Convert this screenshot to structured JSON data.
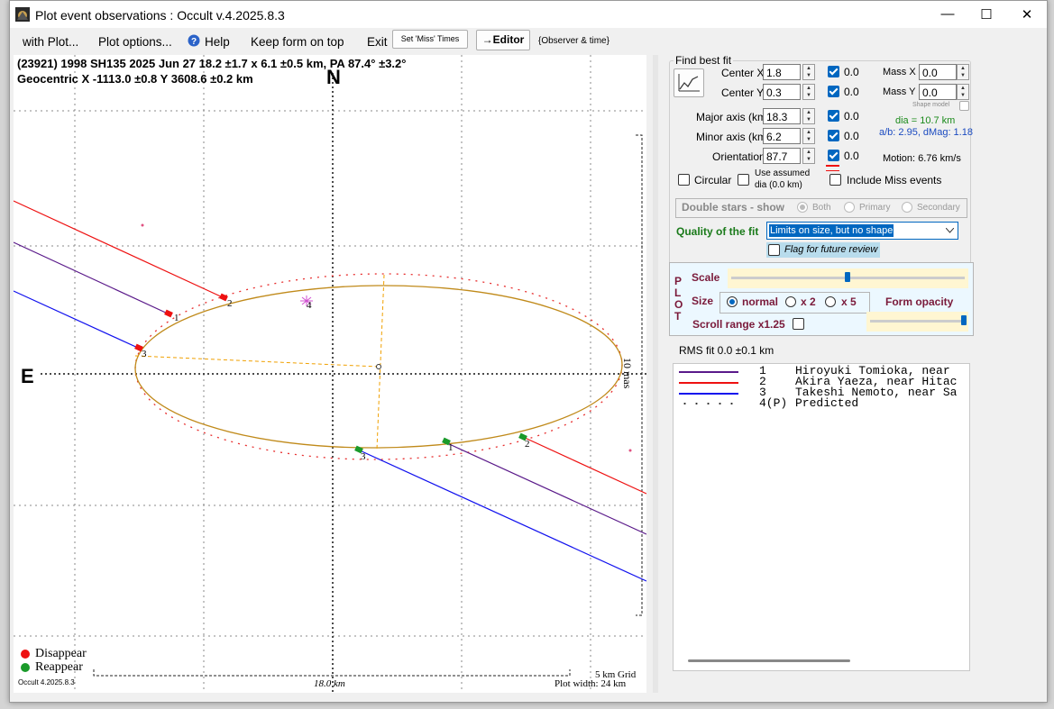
{
  "window": {
    "title": "Plot event observations : Occult v.4.2025.8.3",
    "minimize": "—",
    "maximize": "☐",
    "close": "✕"
  },
  "menu": {
    "with_plot": "with Plot...",
    "plot_options": "Plot options...",
    "help": "Help",
    "keep_on_top": "Keep form on top",
    "exit": "Exit",
    "set_miss_times": "Set 'Miss' Times",
    "editor": "→Editor",
    "observer_time": "{Observer & time}"
  },
  "plot": {
    "header_line1": "(23921) 1998 SH135  2025 Jun 27   18.2 ±1.7 x 6.1 ±0.5 km, PA 87.4° ±3.2°",
    "header_line2": "Geocentric  X  -1113.0 ±0.8  Y 3608.6 ±0.2 km",
    "north": "N",
    "east": "E",
    "scale_mas": "10 mas",
    "scale_km": "18.0 km",
    "grid": "5 km Grid",
    "width": "Plot width: 24 km",
    "version": "Occult 4.2025.8.3",
    "legend_disappear": "Disappear",
    "legend_reappear": "Reappear",
    "chord_labels": [
      "1",
      "2",
      "3",
      "4"
    ],
    "colors": {
      "chord1": "#5a1a8a",
      "chord2": "#ee1111",
      "chord3": "#1111ee",
      "ellipse": "#c08a1a",
      "disappear": "#ee1111",
      "reappear": "#1a9a2a"
    }
  },
  "fit": {
    "group_title": "Find best fit",
    "center_x_label": "Center X",
    "center_x": "1.8",
    "center_x_sd": "0.0",
    "center_y_label": "Center Y",
    "center_y": "0.3",
    "center_y_sd": "0.0",
    "major_label": "Major axis (km)",
    "major": "18.3",
    "major_sd": "0.0",
    "minor_label": "Minor axis (km)",
    "minor": "6.2",
    "minor_sd": "0.0",
    "orientation_label": "Orientation",
    "orientation": "87.7",
    "orientation_sd": "0.0",
    "mass_x_label": "Mass X",
    "mass_x": "0.0",
    "mass_y_label": "Mass Y",
    "mass_y": "0.0",
    "shape_model": "Shape model",
    "dia": "dia = 10.7 km",
    "ab": "a/b: 2.95, dMag: 1.18",
    "motion": "Motion: 6.76 km/s",
    "circular": "Circular",
    "use_assumed": "Use assumed",
    "use_assumed_dia": "dia (0.0 km)",
    "include_miss": "Include Miss events",
    "double_stars": "Double stars - show",
    "both": "Both",
    "primary": "Primary",
    "secondary": "Secondary",
    "quality_label": "Quality of the fit",
    "quality_value": "Limits on size, but no shape",
    "flag_review": "Flag for future review"
  },
  "plotctl": {
    "plot_vertical": [
      "P",
      "L",
      "O",
      "T"
    ],
    "scale": "Scale",
    "size": "Size",
    "normal": "normal",
    "x2": "x 2",
    "x5": "x 5",
    "form_opacity": "Form opacity",
    "scroll_range": "Scroll range x1.25"
  },
  "rms": "RMS fit 0.0 ±0.1 km",
  "observers": [
    {
      "num": "1",
      "name": "Hiroyuki Tomioka, near",
      "color": "#5a1a8a"
    },
    {
      "num": "2",
      "name": "Akira Yaeza, near Hitac",
      "color": "#ee1111"
    },
    {
      "num": "3",
      "name": "Takeshi Nemoto, near Sa",
      "color": "#1111ee"
    },
    {
      "num": "4(P)",
      "name": "Predicted",
      "color": "#333333"
    }
  ]
}
